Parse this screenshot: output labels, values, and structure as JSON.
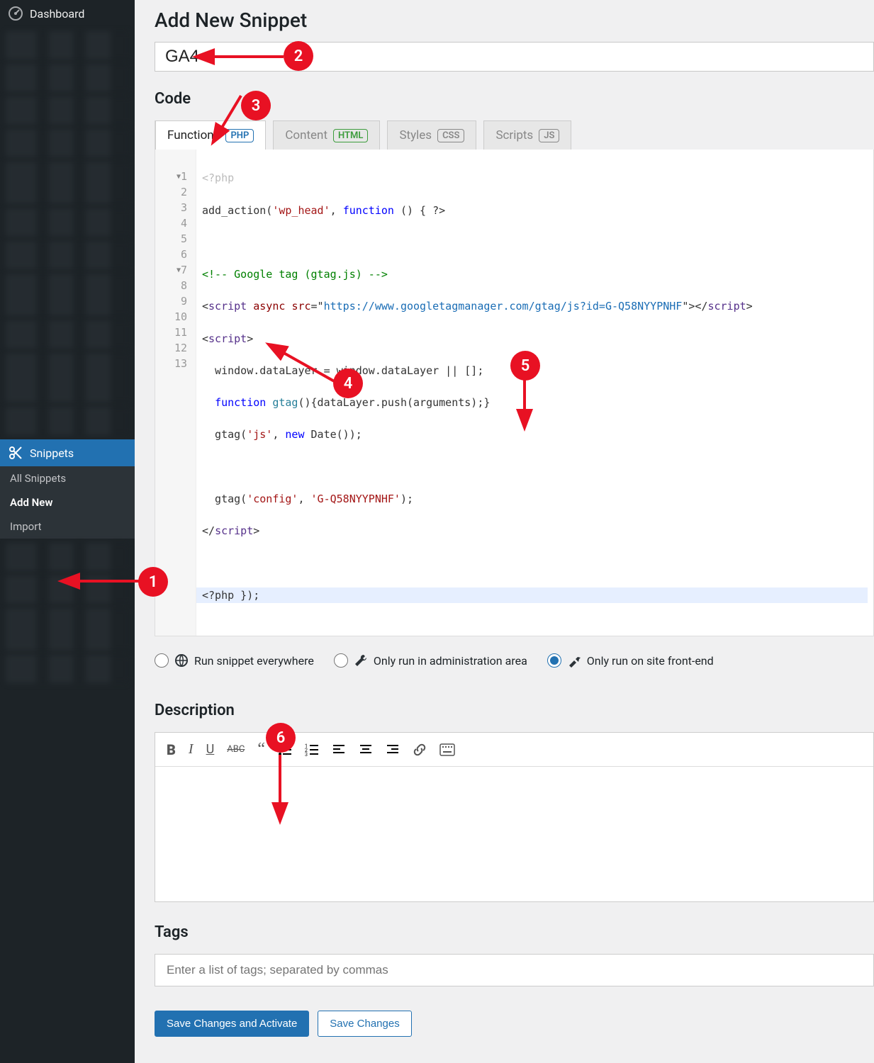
{
  "sidebar": {
    "dashboard": "Dashboard",
    "snippets": "Snippets",
    "submenu": {
      "all": "All Snippets",
      "add": "Add New",
      "import": "Import"
    }
  },
  "page": {
    "title": "Add New Snippet",
    "snippet_title": "GA4",
    "code_heading": "Code",
    "desc_heading": "Description",
    "tags_heading": "Tags"
  },
  "tabs": [
    {
      "label": "Functions",
      "badge": "PHP"
    },
    {
      "label": "Content",
      "badge": "HTML"
    },
    {
      "label": "Styles",
      "badge": "CSS"
    },
    {
      "label": "Scripts",
      "badge": "JS"
    }
  ],
  "code_lines": {
    "prelude": "<?php",
    "l1": {
      "a": "add_action(",
      "b": "'wp_head'",
      "c": ", ",
      "d": "function",
      "e": " () { ?>"
    },
    "l3": "<!-- Google tag (gtag.js) -->",
    "l4_url": "https://www.googletagmanager.com/gtag/js?id=G-Q58NYYPNHF",
    "l6": "  window.dataLayer = window.dataLayer || [];",
    "l7": {
      "kw": "function",
      "name": "gtag",
      "rest": "(){dataLayer.push(arguments);}"
    },
    "l8": {
      "a": "  gtag(",
      "b": "'js'",
      "c": ", ",
      "d": "new",
      "e": " Date());"
    },
    "l10": {
      "a": "  gtag(",
      "b": "'config'",
      "c": ", ",
      "d": "'G-Q58NYYPNHF'",
      "e": ");"
    },
    "l13": "<?php });"
  },
  "scope": {
    "everywhere": "Run snippet everywhere",
    "admin": "Only run in administration area",
    "frontend": "Only run on site front-end"
  },
  "tags_placeholder": "Enter a list of tags; separated by commas",
  "buttons": {
    "save_activate": "Save Changes and Activate",
    "save": "Save Changes"
  },
  "annotations": [
    "1",
    "2",
    "3",
    "4",
    "5",
    "6"
  ]
}
